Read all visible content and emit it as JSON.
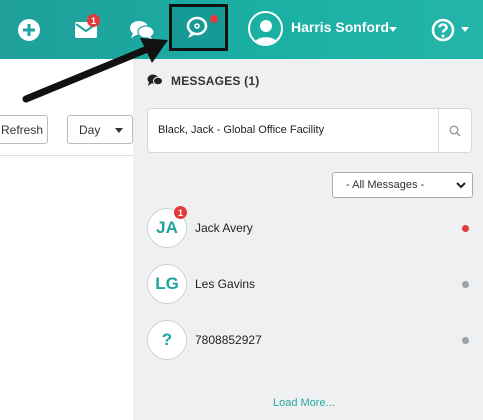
{
  "topbar": {
    "add_icon": "plus-circle-icon",
    "mail_icon": "envelope-icon",
    "mail_badge": "1",
    "chat_icon": "chat-bubbles-icon",
    "messages_icon": "message-search-icon",
    "user_name": "Harris Sonford",
    "help_icon": "question-circle-icon",
    "bar_color": "#1ab0a3"
  },
  "toolbar": {
    "refresh_label": "Refresh",
    "range_value": "Day"
  },
  "messages": {
    "title": "MESSAGES (1)",
    "search_value": "Black, Jack - Global Office Facility",
    "filter_value": "- All Messages -",
    "contacts": [
      {
        "initials": "JA",
        "name": "Jack Avery",
        "badge": "1",
        "status_color": "#e23b3b"
      },
      {
        "initials": "LG",
        "name": "Les Gavins",
        "status_color": "#9aa3a6"
      },
      {
        "initials": "?",
        "name": "7808852927",
        "status_color": "#9aa3a6"
      }
    ],
    "load_more": "Load More..."
  }
}
